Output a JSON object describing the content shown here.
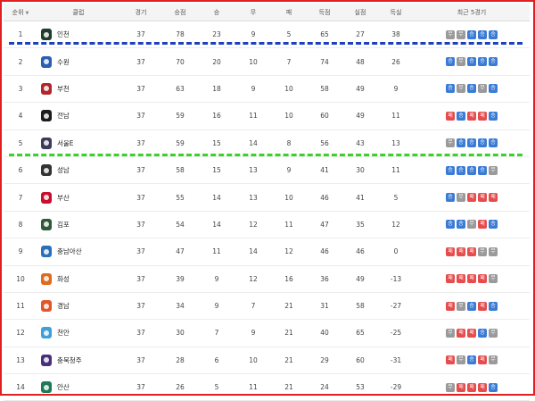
{
  "headers": [
    "순위",
    "클럽",
    "경기",
    "승점",
    "승",
    "무",
    "패",
    "득점",
    "실점",
    "득실",
    "최근 5경기"
  ],
  "colors": {
    "win": "#3a7bd5",
    "draw": "#9a9a9a",
    "loss": "#e64c4c",
    "frame": "#e02020",
    "promotion_line": "#1a3fbf",
    "playoff_line": "#3ad12a"
  },
  "result_labels": {
    "W": "승",
    "D": "무",
    "L": "패"
  },
  "rows": [
    {
      "rank": "1",
      "club": "인천",
      "logo_color": "#1f3d2a",
      "played": "37",
      "points": "78",
      "won": "23",
      "drawn": "9",
      "lost": "5",
      "gf": "65",
      "ga": "27",
      "gd": "38",
      "form": [
        "D",
        "D",
        "W",
        "W",
        "W"
      ]
    },
    {
      "rank": "2",
      "club": "수원",
      "logo_color": "#2b5fb0",
      "played": "37",
      "points": "70",
      "won": "20",
      "drawn": "10",
      "lost": "7",
      "gf": "74",
      "ga": "48",
      "gd": "26",
      "form": [
        "W",
        "D",
        "W",
        "W",
        "W"
      ]
    },
    {
      "rank": "3",
      "club": "부천",
      "logo_color": "#b0262b",
      "played": "37",
      "points": "63",
      "won": "18",
      "drawn": "9",
      "lost": "10",
      "gf": "58",
      "ga": "49",
      "gd": "9",
      "form": [
        "W",
        "D",
        "W",
        "D",
        "W"
      ]
    },
    {
      "rank": "4",
      "club": "전남",
      "logo_color": "#1c1c1c",
      "played": "37",
      "points": "59",
      "won": "16",
      "drawn": "11",
      "lost": "10",
      "gf": "60",
      "ga": "49",
      "gd": "11",
      "form": [
        "L",
        "W",
        "L",
        "L",
        "W"
      ]
    },
    {
      "rank": "5",
      "club": "서울E",
      "logo_color": "#3b3b5c",
      "played": "37",
      "points": "59",
      "won": "15",
      "drawn": "14",
      "lost": "8",
      "gf": "56",
      "ga": "43",
      "gd": "13",
      "form": [
        "D",
        "W",
        "W",
        "W",
        "W"
      ]
    },
    {
      "rank": "6",
      "club": "성남",
      "logo_color": "#333333",
      "played": "37",
      "points": "58",
      "won": "15",
      "drawn": "13",
      "lost": "9",
      "gf": "41",
      "ga": "30",
      "gd": "11",
      "form": [
        "W",
        "W",
        "W",
        "W",
        "D"
      ]
    },
    {
      "rank": "7",
      "club": "부산",
      "logo_color": "#c8102e",
      "played": "37",
      "points": "55",
      "won": "14",
      "drawn": "13",
      "lost": "10",
      "gf": "46",
      "ga": "41",
      "gd": "5",
      "form": [
        "W",
        "D",
        "L",
        "L",
        "L"
      ]
    },
    {
      "rank": "8",
      "club": "김포",
      "logo_color": "#2f5a3a",
      "played": "37",
      "points": "54",
      "won": "14",
      "drawn": "12",
      "lost": "11",
      "gf": "47",
      "ga": "35",
      "gd": "12",
      "form": [
        "W",
        "W",
        "D",
        "L",
        "W"
      ]
    },
    {
      "rank": "9",
      "club": "충남아산",
      "logo_color": "#2a6fb8",
      "played": "37",
      "points": "47",
      "won": "11",
      "drawn": "14",
      "lost": "12",
      "gf": "46",
      "ga": "46",
      "gd": "0",
      "form": [
        "L",
        "L",
        "L",
        "D",
        "D"
      ]
    },
    {
      "rank": "10",
      "club": "화성",
      "logo_color": "#e06a1e",
      "played": "37",
      "points": "39",
      "won": "9",
      "drawn": "12",
      "lost": "16",
      "gf": "36",
      "ga": "49",
      "gd": "-13",
      "form": [
        "L",
        "L",
        "L",
        "L",
        "D"
      ]
    },
    {
      "rank": "11",
      "club": "경남",
      "logo_color": "#e0582a",
      "played": "37",
      "points": "34",
      "won": "9",
      "drawn": "7",
      "lost": "21",
      "gf": "31",
      "ga": "58",
      "gd": "-27",
      "form": [
        "L",
        "D",
        "W",
        "L",
        "W"
      ]
    },
    {
      "rank": "12",
      "club": "천안",
      "logo_color": "#3fa0d8",
      "played": "37",
      "points": "30",
      "won": "7",
      "drawn": "9",
      "lost": "21",
      "gf": "40",
      "ga": "65",
      "gd": "-25",
      "form": [
        "D",
        "L",
        "L",
        "W",
        "D"
      ]
    },
    {
      "rank": "13",
      "club": "충북청주",
      "logo_color": "#4a2f7a",
      "played": "37",
      "points": "28",
      "won": "6",
      "drawn": "10",
      "lost": "21",
      "gf": "29",
      "ga": "60",
      "gd": "-31",
      "form": [
        "L",
        "D",
        "W",
        "L",
        "D"
      ]
    },
    {
      "rank": "14",
      "club": "안산",
      "logo_color": "#1f7a5a",
      "played": "37",
      "points": "26",
      "won": "5",
      "drawn": "11",
      "lost": "21",
      "gf": "24",
      "ga": "53",
      "gd": "-29",
      "form": [
        "D",
        "L",
        "L",
        "L",
        "W"
      ]
    }
  ]
}
